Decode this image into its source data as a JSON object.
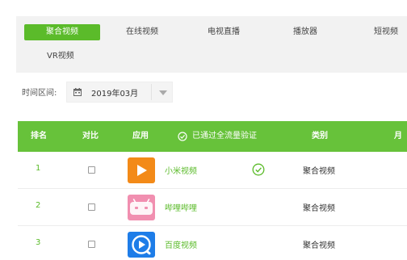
{
  "category_tabs": [
    {
      "label": "聚合视频",
      "active": true
    },
    {
      "label": "在线视频",
      "active": false
    },
    {
      "label": "电视直播",
      "active": false
    },
    {
      "label": "播放器",
      "active": false
    },
    {
      "label": "短视频",
      "active": false
    },
    {
      "label": "VR视频",
      "active": false
    }
  ],
  "date_filter": {
    "label": "时间区间:",
    "value": "2019年03月",
    "icon": "calendar-icon"
  },
  "table": {
    "headers": {
      "rank": "排名",
      "compare": "对比",
      "app": "应用",
      "verified": "已通过全流量验证",
      "category": "类别",
      "month": "月"
    },
    "rows": [
      {
        "rank": "1",
        "name": "小米视频",
        "category": "聚合视频",
        "verified": true,
        "icon": "mi-video-icon"
      },
      {
        "rank": "2",
        "name": "哔哩哔哩",
        "category": "聚合视频",
        "verified": false,
        "icon": "bilibili-icon"
      },
      {
        "rank": "3",
        "name": "百度视频",
        "category": "聚合视频",
        "verified": false,
        "icon": "baidu-video-icon"
      }
    ]
  },
  "colors": {
    "accent": "#5bbb2a",
    "header_bg": "#67c23a",
    "panel_bg": "#f2f2f2"
  }
}
